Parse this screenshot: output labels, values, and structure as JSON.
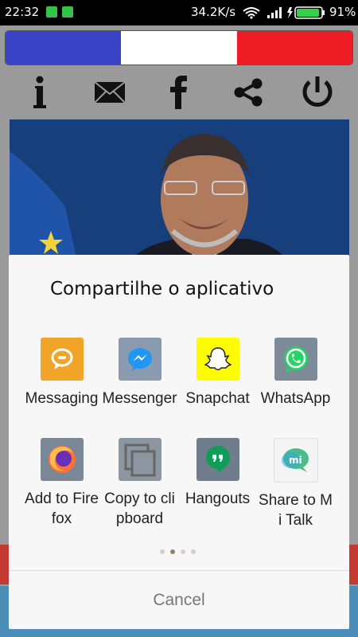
{
  "status_bar": {
    "time": "22:32",
    "network_speed": "34.2K/s",
    "battery": "91%"
  },
  "flag_colors": [
    "#3a44c8",
    "#ffffff",
    "#ee1c25"
  ],
  "toolbar": {
    "icons": [
      "info-icon",
      "mail-icon",
      "facebook-icon",
      "share-icon",
      "power-icon"
    ]
  },
  "share_sheet": {
    "title": "Compartilhe o aplicativo",
    "apps": [
      {
        "label": "Messaging",
        "icon": "messaging-icon",
        "color": "#f0a428"
      },
      {
        "label": "Messenger",
        "icon": "messenger-icon",
        "color": "#2196f3"
      },
      {
        "label": "Snapchat",
        "icon": "snapchat-icon",
        "color": "#fffc00"
      },
      {
        "label": "WhatsApp",
        "icon": "whatsapp-icon",
        "color": "#25d366"
      },
      {
        "label": "Add to Firefox",
        "icon": "firefox-icon",
        "color": "#ff7139"
      },
      {
        "label": "Copy to clipboard",
        "icon": "clipboard-icon",
        "color": "#9e9e9e"
      },
      {
        "label": "Hangouts",
        "icon": "hangouts-icon",
        "color": "#0f9d58"
      },
      {
        "label": "Share to Mi Talk",
        "icon": "mitalk-icon",
        "color": "#4cbb8a"
      }
    ],
    "pager": {
      "pages": 4,
      "current": 2
    },
    "cancel_label": "Cancel"
  }
}
